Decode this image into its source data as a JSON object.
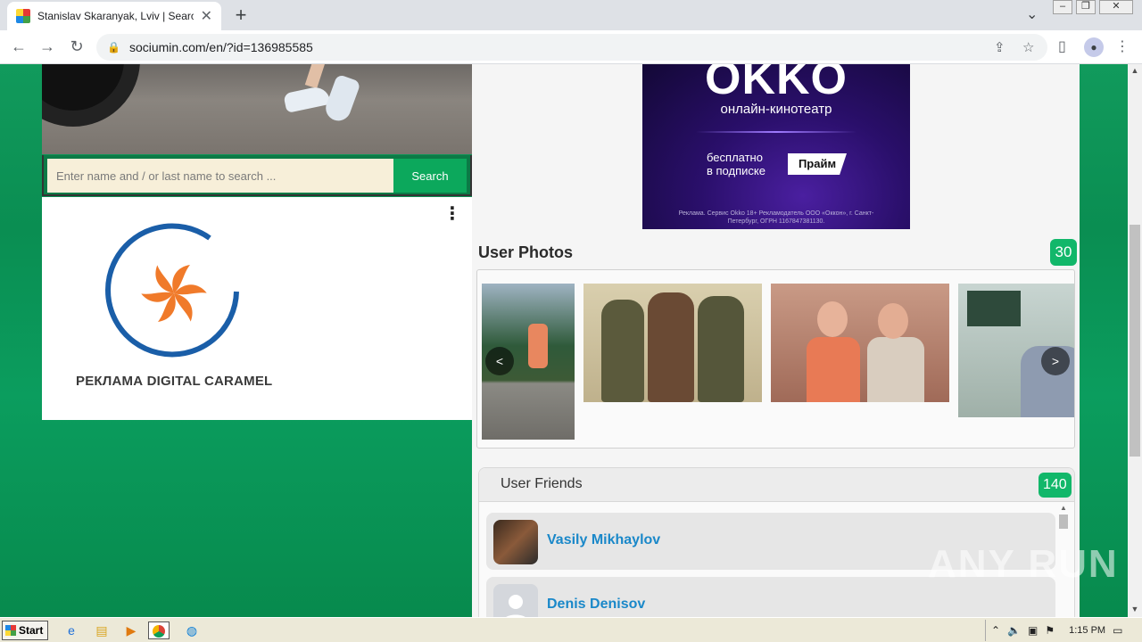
{
  "browser": {
    "tab_title": "Stanislav Skaranyak, Lviv | Search I",
    "url": "sociumin.com/en/?id=136985585"
  },
  "search": {
    "placeholder": "Enter name and / or last name to search ...",
    "button_label": "Search"
  },
  "ad_left": {
    "caption": "РЕКЛАМА DIGITAL CARAMEL"
  },
  "ad_okko": {
    "logo": "OKKO",
    "subtitle": "онлайн-кинотеатр",
    "offer_line1": "бесплатно",
    "offer_line2": "в подписке",
    "badge": "Прайм",
    "legal": "Реклама. Сервис Okko 18+ Рекламодатель ООО «Оккон», г. Санкт-Петербург, ОГРН 1167847381130."
  },
  "photos": {
    "title": "User Photos",
    "count": "30",
    "prev_label": "<",
    "next_label": ">"
  },
  "friends": {
    "title": "User Friends",
    "count": "140",
    "items": [
      {
        "name": "Vasily Mikhaylov"
      },
      {
        "name": "Denis Denisov"
      }
    ]
  },
  "taskbar": {
    "start_label": "Start",
    "clock": "1:15 PM"
  },
  "watermark": "ANY RUN"
}
